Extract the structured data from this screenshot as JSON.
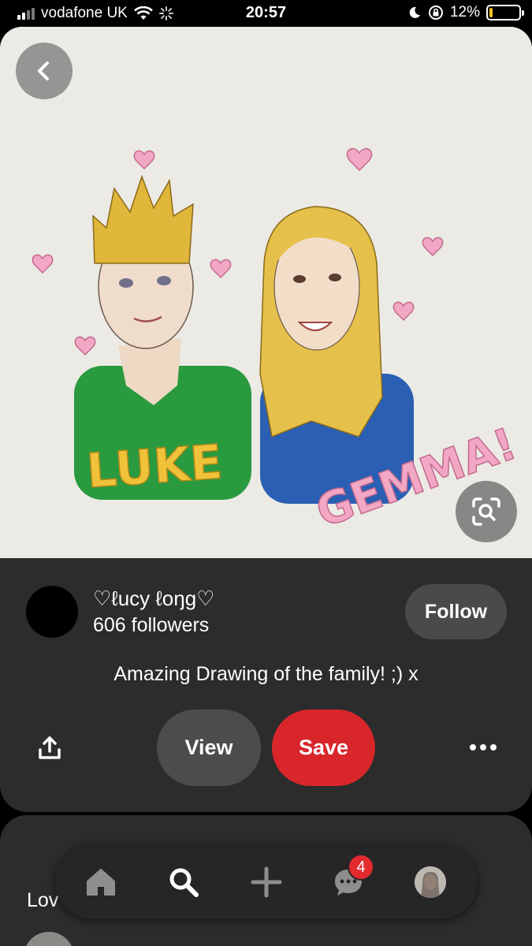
{
  "status_bar": {
    "carrier": "vodafone UK",
    "time": "20:57",
    "battery_percent": "12%",
    "battery_level": 0.12,
    "battery_color": "#f3c623"
  },
  "pin": {
    "image_name_labels": [
      "LUKE",
      "GEMMA!"
    ],
    "back_icon": "chevron-left-icon",
    "visual_search_icon": "lens-search-icon"
  },
  "author": {
    "name": "♡ℓucy ℓoŋg♡",
    "followers": "606 followers",
    "follow_label": "Follow"
  },
  "description": "Amazing Drawing of the family! ;) x",
  "actions": {
    "share_icon": "share-icon",
    "view_label": "View",
    "save_label": "Save",
    "more_icon": "more-horizontal-icon",
    "save_color": "#d8262b"
  },
  "next_card": {
    "text": "Lov"
  },
  "bottom_nav": {
    "items": [
      "home-icon",
      "search-icon",
      "plus-icon",
      "messages-icon",
      "profile-avatar"
    ],
    "messages_badge": "4"
  }
}
